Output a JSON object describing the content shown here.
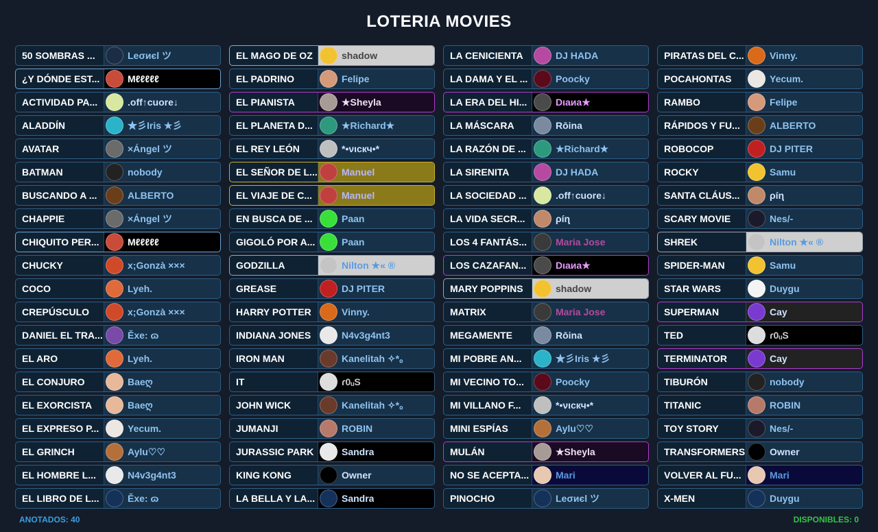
{
  "title": "LOTERIA MOVIES",
  "footer": {
    "anotados": "ANOTADOS: 40",
    "disponibles": "DISPONIBLES: 0"
  },
  "colors": {
    "background": "#141c2a",
    "card_border": "#2f5f86",
    "highlight_border": "#b33cd3",
    "name_blue": "#8fc3f0",
    "anotados": "#3aa0e0",
    "disponibles": "#35c24a"
  },
  "columns": [
    [
      {
        "movie": "50 SOMBRAS ...",
        "user": "Leσиєl ツ",
        "avatar": "#1b2d44",
        "name_color": "#8fc3f0",
        "bg": "#173148",
        "border": "#2f5f86"
      },
      {
        "movie": "¿Y DÓNDE EST...",
        "user": "Mℓℓℓℓℓ",
        "avatar": "#c94b3a",
        "name_color": "#ffffff",
        "bg": "#000000",
        "border": "#6aa6d9"
      },
      {
        "movie": "ACTIVIDAD PA...",
        "user": ".off↑cuore↓",
        "avatar": "#d9e8a0",
        "name_color": "#cfe3ff",
        "bg": "#173148",
        "border": "#2f5f86"
      },
      {
        "movie": "ALADDÍN",
        "user": "★彡Iris ★彡",
        "avatar": "#2bb4c9",
        "name_color": "#8fc3f0",
        "bg": "#173148",
        "border": "#2f5f86"
      },
      {
        "movie": "AVATAR",
        "user": "×Ángel ツ",
        "avatar": "#6b6b6b",
        "name_color": "#8fc3f0",
        "bg": "#173148",
        "border": "#2f5f86"
      },
      {
        "movie": "BATMAN",
        "user": "nobody",
        "avatar": "#222222",
        "name_color": "#8fc3f0",
        "bg": "#173148",
        "border": "#2f5f86"
      },
      {
        "movie": "BUSCANDO A ...",
        "user": "ALBERTO",
        "avatar": "#6b3e1a",
        "name_color": "#8fc3f0",
        "bg": "#173148",
        "border": "#2f5f86"
      },
      {
        "movie": "CHAPPIE",
        "user": "×Ángel ツ",
        "avatar": "#6b6b6b",
        "name_color": "#8fc3f0",
        "bg": "#173148",
        "border": "#2f5f86"
      },
      {
        "movie": "CHIQUITO PER...",
        "user": "Mℓℓℓℓℓ",
        "avatar": "#c94b3a",
        "name_color": "#ffffff",
        "bg": "#000000",
        "border": "#6aa6d9"
      },
      {
        "movie": "CHUCKY",
        "user": "x;Gonzà ×××",
        "avatar": "#d04a2a",
        "name_color": "#8fc3f0",
        "bg": "#173148",
        "border": "#2f5f86"
      },
      {
        "movie": "COCO",
        "user": "Lyeh.",
        "avatar": "#e06a3a",
        "name_color": "#8fc3f0",
        "bg": "#173148",
        "border": "#2f5f86"
      },
      {
        "movie": "CREPÚSCULO",
        "user": "x;Gonzà ×××",
        "avatar": "#d04a2a",
        "name_color": "#8fc3f0",
        "bg": "#173148",
        "border": "#2f5f86"
      },
      {
        "movie": "DANIEL EL TRA...",
        "user": "Ěxe: ɷ",
        "avatar": "#7a4aa8",
        "name_color": "#8fc3f0",
        "bg": "#173148",
        "border": "#2f5f86"
      },
      {
        "movie": "EL ARO",
        "user": "Lyeh.",
        "avatar": "#e06a3a",
        "name_color": "#8fc3f0",
        "bg": "#173148",
        "border": "#2f5f86"
      },
      {
        "movie": "EL CONJURO",
        "user": "Baeღ",
        "avatar": "#e8b89a",
        "name_color": "#8fc3f0",
        "bg": "#173148",
        "border": "#2f5f86"
      },
      {
        "movie": "EL EXORCISTA",
        "user": "Baeღ",
        "avatar": "#e8b89a",
        "name_color": "#8fc3f0",
        "bg": "#173148",
        "border": "#2f5f86"
      },
      {
        "movie": "EL EXPRESO P...",
        "user": "Yecum.",
        "avatar": "#ece7e2",
        "name_color": "#8fc3f0",
        "bg": "#173148",
        "border": "#2f5f86"
      },
      {
        "movie": "EL GRINCH",
        "user": "Aylu♡♡",
        "avatar": "#b5703a",
        "name_color": "#8fc3f0",
        "bg": "#173148",
        "border": "#2f5f86"
      },
      {
        "movie": "EL HOMBRE L...",
        "user": "N4v3g4nt3",
        "avatar": "#e9e9e9",
        "name_color": "#8fc3f0",
        "bg": "#173148",
        "border": "#2f5f86"
      },
      {
        "movie": "EL LIBRO DE L...",
        "user": "Ěxe: ɷ",
        "avatar": "#14315a",
        "name_color": "#8fc3f0",
        "bg": "#173148",
        "border": "#2f5f86"
      }
    ],
    [
      {
        "movie": "EL MAGO DE OZ",
        "user": "shadow",
        "avatar": "#f2c230",
        "name_color": "#444444",
        "bg": "#cfcfcf",
        "border": "#9aa6b2"
      },
      {
        "movie": "EL PADRINO",
        "user": "Felipe",
        "avatar": "#d49a7a",
        "name_color": "#8fc3f0",
        "bg": "#173148",
        "border": "#2f5f86"
      },
      {
        "movie": "EL PIANISTA",
        "user": "★Sheyla",
        "avatar": "#a79b96",
        "name_color": "#f0e0f0",
        "bg": "#1a0a24",
        "border": "#b33cd3"
      },
      {
        "movie": "EL PLANETA D...",
        "user": "★Richard★",
        "avatar": "#2d9a7d",
        "name_color": "#8fc3f0",
        "bg": "#173148",
        "border": "#2f5f86"
      },
      {
        "movie": "EL REY LEÓN",
        "user": "*•νιcкч•*",
        "avatar": "#bfbfbf",
        "name_color": "#cfe3ff",
        "bg": "#173148",
        "border": "#2f5f86"
      },
      {
        "movie": "EL SEÑOR DE L...",
        "user": "Manuel",
        "avatar": "#c04040",
        "name_color": "#b7b7ff",
        "bg": "#8a7a1a",
        "border": "#c9b030"
      },
      {
        "movie": "EL VIAJE DE C...",
        "user": "Manuel",
        "avatar": "#c04040",
        "name_color": "#b7b7ff",
        "bg": "#8a7a1a",
        "border": "#c9b030"
      },
      {
        "movie": "EN BUSCA DE ...",
        "user": "Paan",
        "avatar": "#3ae03a",
        "name_color": "#8fc3f0",
        "bg": "#173148",
        "border": "#2f5f86"
      },
      {
        "movie": "GIGOLÓ POR A...",
        "user": "Paan",
        "avatar": "#3ae03a",
        "name_color": "#8fc3f0",
        "bg": "#173148",
        "border": "#2f5f86"
      },
      {
        "movie": "GODZILLA",
        "user": "Nilton ★« ®",
        "avatar": "#c4c4c4",
        "name_color": "#5a9ae0",
        "bg": "#cfcfcf",
        "border": "#9aa6b2"
      },
      {
        "movie": "GREASE",
        "user": "DJ PITER",
        "avatar": "#c02020",
        "name_color": "#8fc3f0",
        "bg": "#173148",
        "border": "#2f5f86"
      },
      {
        "movie": "HARRY POTTER",
        "user": "Vinny.",
        "avatar": "#d86a1a",
        "name_color": "#8fc3f0",
        "bg": "#173148",
        "border": "#2f5f86"
      },
      {
        "movie": "INDIANA JONES",
        "user": "N4v3g4nt3",
        "avatar": "#e9e9e9",
        "name_color": "#8fc3f0",
        "bg": "#173148",
        "border": "#2f5f86"
      },
      {
        "movie": "IRON MAN",
        "user": "Kanelitah ✧*。",
        "avatar": "#6a3a2a",
        "name_color": "#8fc3f0",
        "bg": "#173148",
        "border": "#2f5f86"
      },
      {
        "movie": "IT",
        "user": "ɾ0ᵤS",
        "avatar": "#dddddd",
        "name_color": "#cccccc",
        "bg": "#000000",
        "border": "#2f5f86"
      },
      {
        "movie": "JOHN WICK",
        "user": "Kanelitah ✧*。",
        "avatar": "#6a3a2a",
        "name_color": "#8fc3f0",
        "bg": "#173148",
        "border": "#2f5f86"
      },
      {
        "movie": "JUMANJI",
        "user": "ROBIN",
        "avatar": "#b77a6a",
        "name_color": "#8fc3f0",
        "bg": "#173148",
        "border": "#2f5f86"
      },
      {
        "movie": "JURASSIC PARK",
        "user": "Sandra",
        "avatar": "#e8e8e8",
        "name_color": "#cfe3ff",
        "bg": "#000000",
        "border": "#2f5f86"
      },
      {
        "movie": "KING KONG",
        "user": "Owner",
        "avatar": "#000000",
        "name_color": "#cfe3ff",
        "bg": "#173148",
        "border": "#2f5f86"
      },
      {
        "movie": "LA BELLA Y LA...",
        "user": "Sandra",
        "avatar": "#14315a",
        "name_color": "#cfe3ff",
        "bg": "#000000",
        "border": "#2f5f86"
      }
    ],
    [
      {
        "movie": "LA CENICIENTA",
        "user": "DJ HADA",
        "avatar": "#b54aa0",
        "name_color": "#8fc3f0",
        "bg": "#173148",
        "border": "#2f5f86"
      },
      {
        "movie": "LA DAMA Y EL ...",
        "user": "Poocky",
        "avatar": "#5a0a1a",
        "name_color": "#8fc3f0",
        "bg": "#173148",
        "border": "#2f5f86"
      },
      {
        "movie": "LA ERA DEL HI...",
        "user": "Dιaиa★",
        "avatar": "#4a4a4a",
        "name_color": "#e89aff",
        "bg": "#000000",
        "border": "#b33cd3"
      },
      {
        "movie": "LA MÁSCARA",
        "user": "Rōina",
        "avatar": "#7a8aa0",
        "name_color": "#cfe3ff",
        "bg": "#173148",
        "border": "#2f5f86"
      },
      {
        "movie": "LA RAZÓN DE ...",
        "user": "★Richard★",
        "avatar": "#2d9a7d",
        "name_color": "#8fc3f0",
        "bg": "#173148",
        "border": "#2f5f86"
      },
      {
        "movie": "LA SIRENITA",
        "user": "DJ HADA",
        "avatar": "#b54aa0",
        "name_color": "#8fc3f0",
        "bg": "#173148",
        "border": "#2f5f86"
      },
      {
        "movie": "LA SOCIEDAD ...",
        "user": ".off↑cuore↓",
        "avatar": "#d9e8a0",
        "name_color": "#cfe3ff",
        "bg": "#173148",
        "border": "#2f5f86"
      },
      {
        "movie": "LA VIDA SECR...",
        "user": "ρíɳ",
        "avatar": "#c08a6a",
        "name_color": "#cfe3ff",
        "bg": "#173148",
        "border": "#2f5f86"
      },
      {
        "movie": "LOS 4 FANTÁS...",
        "user": "Maria Jose",
        "avatar": "#3a3a3a",
        "name_color": "#b54aa0",
        "bg": "#173148",
        "border": "#2f5f86"
      },
      {
        "movie": "LOS CAZAFAN...",
        "user": "Dιaиa★",
        "avatar": "#4a4a4a",
        "name_color": "#e89aff",
        "bg": "#000000",
        "border": "#b33cd3"
      },
      {
        "movie": "MARY POPPINS",
        "user": "shadow",
        "avatar": "#f2c230",
        "name_color": "#444444",
        "bg": "#cfcfcf",
        "border": "#9aa6b2"
      },
      {
        "movie": "MATRIX",
        "user": "Maria Jose",
        "avatar": "#3a3a3a",
        "name_color": "#b54aa0",
        "bg": "#173148",
        "border": "#2f5f86"
      },
      {
        "movie": "MEGAMENTE",
        "user": "Rōina",
        "avatar": "#7a8aa0",
        "name_color": "#cfe3ff",
        "bg": "#173148",
        "border": "#2f5f86"
      },
      {
        "movie": "MI POBRE AN...",
        "user": "★彡Iris ★彡",
        "avatar": "#2bb4c9",
        "name_color": "#8fc3f0",
        "bg": "#173148",
        "border": "#2f5f86"
      },
      {
        "movie": "MI VECINO TO...",
        "user": "Poocky",
        "avatar": "#5a0a1a",
        "name_color": "#8fc3f0",
        "bg": "#173148",
        "border": "#2f5f86"
      },
      {
        "movie": "MI VILLANO F...",
        "user": "*•νιcкч•*",
        "avatar": "#bfbfbf",
        "name_color": "#cfe3ff",
        "bg": "#173148",
        "border": "#2f5f86"
      },
      {
        "movie": "MINI ESPÍAS",
        "user": "Aylu♡♡",
        "avatar": "#b5703a",
        "name_color": "#8fc3f0",
        "bg": "#173148",
        "border": "#2f5f86"
      },
      {
        "movie": "MULÁN",
        "user": "★Sheyla",
        "avatar": "#a79b96",
        "name_color": "#f0e0f0",
        "bg": "#1a0a24",
        "border": "#b33cd3"
      },
      {
        "movie": "NO SE ACEPTA...",
        "user": "Mari",
        "avatar": "#e8c8b0",
        "name_color": "#5a9ae0",
        "bg": "#0a0a3a",
        "border": "#2f5f86"
      },
      {
        "movie": "PINOCHO",
        "user": "Leσиєl ツ",
        "avatar": "#14315a",
        "name_color": "#8fc3f0",
        "bg": "#173148",
        "border": "#2f5f86"
      }
    ],
    [
      {
        "movie": "PIRATAS DEL C...",
        "user": "Vinny.",
        "avatar": "#d86a1a",
        "name_color": "#8fc3f0",
        "bg": "#173148",
        "border": "#2f5f86"
      },
      {
        "movie": "POCAHONTAS",
        "user": "Yecum.",
        "avatar": "#ece7e2",
        "name_color": "#8fc3f0",
        "bg": "#173148",
        "border": "#2f5f86"
      },
      {
        "movie": "RAMBO",
        "user": "Felipe",
        "avatar": "#d49a7a",
        "name_color": "#8fc3f0",
        "bg": "#173148",
        "border": "#2f5f86"
      },
      {
        "movie": "RÁPIDOS Y FU...",
        "user": "ALBERTO",
        "avatar": "#6b3e1a",
        "name_color": "#8fc3f0",
        "bg": "#173148",
        "border": "#2f5f86"
      },
      {
        "movie": "ROBOCOP",
        "user": "DJ PITER",
        "avatar": "#c02020",
        "name_color": "#8fc3f0",
        "bg": "#173148",
        "border": "#2f5f86"
      },
      {
        "movie": "ROCKY",
        "user": "Samu",
        "avatar": "#f2c230",
        "name_color": "#8fc3f0",
        "bg": "#173148",
        "border": "#2f5f86"
      },
      {
        "movie": "SANTA CLÁUS...",
        "user": "ρíɳ",
        "avatar": "#c08a6a",
        "name_color": "#cfe3ff",
        "bg": "#173148",
        "border": "#2f5f86"
      },
      {
        "movie": "SCARY MOVIE",
        "user": "Nes/-",
        "avatar": "#1a1a2a",
        "name_color": "#8fc3f0",
        "bg": "#173148",
        "border": "#2f5f86"
      },
      {
        "movie": "SHREK",
        "user": "Nilton ★« ®",
        "avatar": "#c4c4c4",
        "name_color": "#5a9ae0",
        "bg": "#cfcfcf",
        "border": "#9aa6b2"
      },
      {
        "movie": "SPIDER-MAN",
        "user": "Samu",
        "avatar": "#f2c230",
        "name_color": "#8fc3f0",
        "bg": "#173148",
        "border": "#2f5f86"
      },
      {
        "movie": "STAR WARS",
        "user": "Duygu",
        "avatar": "#f4f4f4",
        "name_color": "#8fc3f0",
        "bg": "#173148",
        "border": "#2f5f86"
      },
      {
        "movie": "SUPERMAN",
        "user": "Cay",
        "avatar": "#7a3ad0",
        "name_color": "#cfe3ff",
        "bg": "#222222",
        "border": "#b33cd3"
      },
      {
        "movie": "TED",
        "user": "ɾ0ᵤS",
        "avatar": "#dddddd",
        "name_color": "#cccccc",
        "bg": "#000000",
        "border": "#2f5f86"
      },
      {
        "movie": "TERMINATOR",
        "user": "Cay",
        "avatar": "#7a3ad0",
        "name_color": "#cfe3ff",
        "bg": "#222222",
        "border": "#b33cd3"
      },
      {
        "movie": "TIBURÓN",
        "user": "nobody",
        "avatar": "#222222",
        "name_color": "#8fc3f0",
        "bg": "#173148",
        "border": "#2f5f86"
      },
      {
        "movie": "TITANIC",
        "user": "ROBIN",
        "avatar": "#b77a6a",
        "name_color": "#8fc3f0",
        "bg": "#173148",
        "border": "#2f5f86"
      },
      {
        "movie": "TOY STORY",
        "user": "Nes/-",
        "avatar": "#1a1a2a",
        "name_color": "#8fc3f0",
        "bg": "#173148",
        "border": "#2f5f86"
      },
      {
        "movie": "TRANSFORMERS",
        "user": "Owner",
        "avatar": "#000000",
        "name_color": "#cfe3ff",
        "bg": "#173148",
        "border": "#2f5f86"
      },
      {
        "movie": "VOLVER AL FU...",
        "user": "Mari",
        "avatar": "#e8c8b0",
        "name_color": "#5a9ae0",
        "bg": "#0a0a3a",
        "border": "#2f5f86"
      },
      {
        "movie": "X-MEN",
        "user": "Duygu",
        "avatar": "#14315a",
        "name_color": "#8fc3f0",
        "bg": "#173148",
        "border": "#2f5f86"
      }
    ]
  ]
}
